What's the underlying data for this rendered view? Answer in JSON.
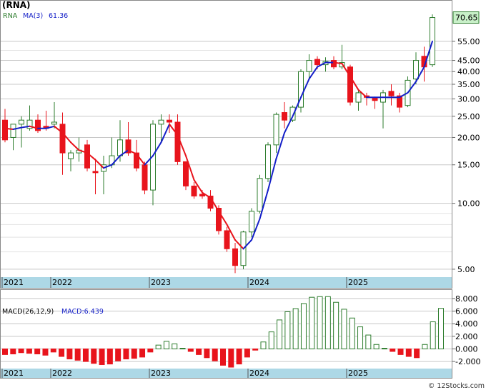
{
  "title": "(RNA)",
  "legend": {
    "symbol": "RNA",
    "ma_label": "MA(3)",
    "ma_value": "61.36"
  },
  "macd_legend": {
    "label": "MACD(26,12,9)",
    "value_label": "MACD:6.439"
  },
  "last_price": "70.65",
  "footer": "© 12Stocks.com",
  "colors": {
    "up": "#2e7d2e",
    "down": "#e8141c",
    "ma_red": "#e8141c",
    "ma_blue": "#1520c8",
    "band": "#add8e6",
    "last_label_bg": "#c8f0c8"
  },
  "chart_data": {
    "type": "candlestick",
    "price_scale": "log",
    "ylim": [
      4.6,
      80
    ],
    "price_ticks": [
      "70.65",
      "55.00",
      "45.00",
      "40.00",
      "35.00",
      "30.00",
      "25.00",
      "20.00",
      "15.00",
      "10.00",
      "5.00"
    ],
    "year_labels": [
      "2021",
      "2022",
      "2023",
      "2024",
      "2025"
    ],
    "candles": [
      {
        "o": 24,
        "h": 27,
        "l": 19,
        "c": 19.5
      },
      {
        "o": 20,
        "h": 23,
        "l": 17.5,
        "c": 23
      },
      {
        "o": 23,
        "h": 25,
        "l": 18,
        "c": 24
      },
      {
        "o": 22,
        "h": 28,
        "l": 21.5,
        "c": 24
      },
      {
        "o": 24,
        "h": 25.5,
        "l": 21,
        "c": 21.5
      },
      {
        "o": 22.5,
        "h": 26.5,
        "l": 21.5,
        "c": 22
      },
      {
        "o": 23,
        "h": 29,
        "l": 22,
        "c": 23.5
      },
      {
        "o": 23,
        "h": 26,
        "l": 13.5,
        "c": 17
      },
      {
        "o": 16,
        "h": 17.5,
        "l": 14,
        "c": 17
      },
      {
        "o": 17,
        "h": 20,
        "l": 15.5,
        "c": 17.5
      },
      {
        "o": 18.5,
        "h": 19.5,
        "l": 14,
        "c": 14.5
      },
      {
        "o": 14,
        "h": 16,
        "l": 11,
        "c": 13.8
      },
      {
        "o": 14,
        "h": 16.5,
        "l": 11,
        "c": 15
      },
      {
        "o": 15,
        "h": 20,
        "l": 14.5,
        "c": 16.5
      },
      {
        "o": 16.5,
        "h": 24,
        "l": 15.5,
        "c": 19.5
      },
      {
        "o": 19.5,
        "h": 23.5,
        "l": 16.5,
        "c": 17
      },
      {
        "o": 17,
        "h": 19.5,
        "l": 14,
        "c": 14.5
      },
      {
        "o": 15,
        "h": 15.5,
        "l": 11,
        "c": 11.5
      },
      {
        "o": 11.5,
        "h": 24,
        "l": 9.8,
        "c": 23
      },
      {
        "o": 23,
        "h": 25.5,
        "l": 19,
        "c": 24
      },
      {
        "o": 24,
        "h": 25.5,
        "l": 21,
        "c": 23.5
      },
      {
        "o": 23.5,
        "h": 25.5,
        "l": 15,
        "c": 15.5
      },
      {
        "o": 15.5,
        "h": 15.5,
        "l": 11.5,
        "c": 12
      },
      {
        "o": 12,
        "h": 12.5,
        "l": 10.5,
        "c": 10.8
      },
      {
        "o": 11,
        "h": 11.5,
        "l": 10.5,
        "c": 10.8
      },
      {
        "o": 10.8,
        "h": 11.5,
        "l": 9.2,
        "c": 9.5
      },
      {
        "o": 9.5,
        "h": 9.8,
        "l": 7.2,
        "c": 7.5
      },
      {
        "o": 7.5,
        "h": 7.8,
        "l": 6,
        "c": 6.2
      },
      {
        "o": 6.2,
        "h": 6.6,
        "l": 4.8,
        "c": 5.2
      },
      {
        "o": 5.2,
        "h": 7.5,
        "l": 5,
        "c": 7.4
      },
      {
        "o": 7.4,
        "h": 9.5,
        "l": 7,
        "c": 9.2
      },
      {
        "o": 9.2,
        "h": 13.5,
        "l": 9,
        "c": 13
      },
      {
        "o": 13,
        "h": 19,
        "l": 12.5,
        "c": 18.5
      },
      {
        "o": 18.5,
        "h": 26,
        "l": 17,
        "c": 25.5
      },
      {
        "o": 26,
        "h": 29,
        "l": 22,
        "c": 24
      },
      {
        "o": 24,
        "h": 28,
        "l": 23.5,
        "c": 27.5
      },
      {
        "o": 27.5,
        "h": 41,
        "l": 26,
        "c": 40
      },
      {
        "o": 40,
        "h": 48,
        "l": 37,
        "c": 45
      },
      {
        "o": 45.5,
        "h": 47,
        "l": 41,
        "c": 43
      },
      {
        "o": 43,
        "h": 46.5,
        "l": 40,
        "c": 44.5
      },
      {
        "o": 45,
        "h": 47,
        "l": 41,
        "c": 42
      },
      {
        "o": 42,
        "h": 53,
        "l": 41,
        "c": 44
      },
      {
        "o": 42,
        "h": 43,
        "l": 28,
        "c": 29
      },
      {
        "o": 29,
        "h": 33,
        "l": 26.5,
        "c": 32
      },
      {
        "o": 31,
        "h": 32,
        "l": 28,
        "c": 30.5
      },
      {
        "o": 30.5,
        "h": 30.5,
        "l": 27,
        "c": 29.5
      },
      {
        "o": 29,
        "h": 33,
        "l": 22,
        "c": 32
      },
      {
        "o": 32.5,
        "h": 35,
        "l": 28,
        "c": 31
      },
      {
        "o": 31,
        "h": 32,
        "l": 26,
        "c": 27.5
      },
      {
        "o": 28,
        "h": 38,
        "l": 27.5,
        "c": 36.5
      },
      {
        "o": 37,
        "h": 49,
        "l": 35,
        "c": 45
      },
      {
        "o": 47,
        "h": 52,
        "l": 36,
        "c": 42
      },
      {
        "o": 43,
        "h": 73,
        "l": 42,
        "c": 70.65
      }
    ],
    "ma3": [
      22,
      21.8,
      22.2,
      22.5,
      22,
      22,
      22.5,
      21,
      19,
      17.5,
      17,
      15.8,
      14.5,
      15,
      16.5,
      17.5,
      16.8,
      15,
      16.5,
      19,
      23,
      20.5,
      16.5,
      12.8,
      11.2,
      10.6,
      9.2,
      8,
      6.8,
      6.2,
      6.8,
      8.5,
      11.5,
      16,
      21,
      25,
      30.5,
      37,
      42,
      44,
      44,
      43.5,
      38,
      33,
      30.5,
      30.5,
      30.5,
      30.5,
      30.5,
      32,
      36,
      42,
      55,
      61.36
    ],
    "macd": [
      -0.9,
      -0.8,
      -0.6,
      -0.7,
      -0.8,
      -1.0,
      -0.5,
      -1.2,
      -1.6,
      -1.8,
      -2.0,
      -2.3,
      -2.5,
      -2.4,
      -1.9,
      -1.6,
      -1.5,
      -1.3,
      -0.5,
      0.6,
      1.2,
      0.8,
      0.1,
      -0.4,
      -0.9,
      -1.4,
      -1.9,
      -2.6,
      -2.9,
      -2.4,
      -1.3,
      -0.2,
      1.1,
      2.7,
      4.6,
      5.9,
      6.4,
      7.2,
      8.2,
      8.3,
      8.3,
      7.4,
      6.3,
      4.9,
      3.5,
      2.2,
      0.7,
      0.1,
      -0.4,
      -0.9,
      -1.2,
      -1.4,
      0.7,
      4.3,
      6.439
    ],
    "macd_ticks": [
      "8.000",
      "6.000",
      "4.000",
      "2.000",
      "0.000",
      "-2.000"
    ],
    "macd_ylim": [
      -2.9,
      8.9
    ]
  }
}
